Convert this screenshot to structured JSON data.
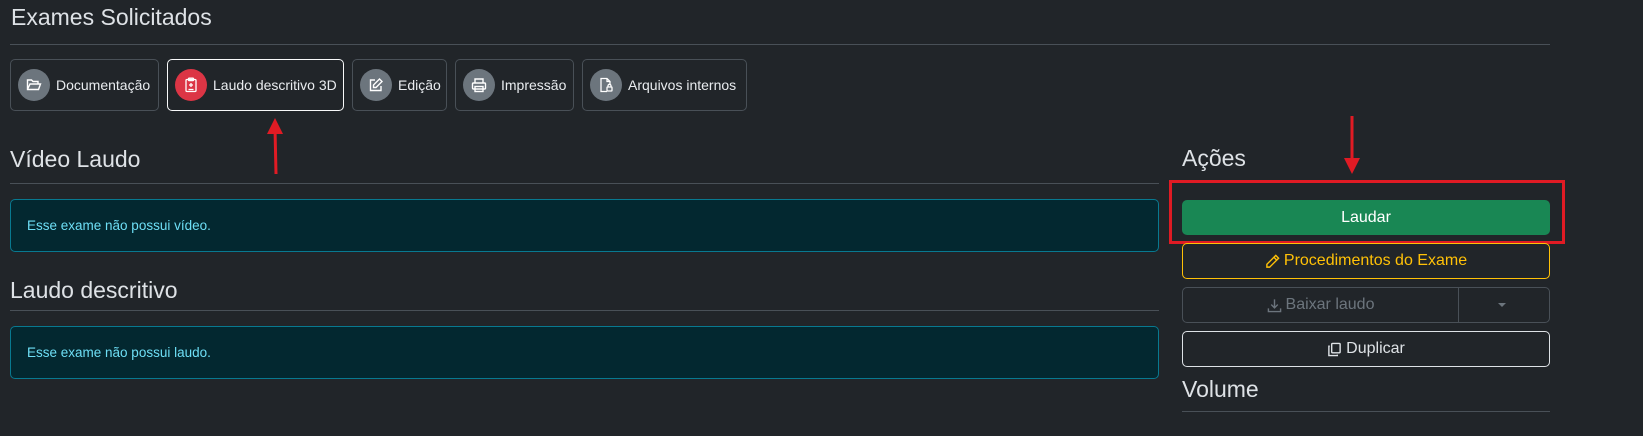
{
  "header": {
    "title": "Exames Solicitados"
  },
  "tabs": [
    {
      "label": "Documentação",
      "icon": "folder-open-icon",
      "active": false
    },
    {
      "label": "Laudo descritivo 3D",
      "icon": "clipboard-medical-icon",
      "active": true
    },
    {
      "label": "Edição",
      "icon": "edit-icon",
      "active": false
    },
    {
      "label": "Impressão",
      "icon": "printer-icon",
      "active": false
    },
    {
      "label": "Arquivos internos",
      "icon": "file-lock-icon",
      "active": false
    }
  ],
  "video_section": {
    "title": "Vídeo Laudo",
    "alert": "Esse exame não possui vídeo."
  },
  "laudo_section": {
    "title": "Laudo descritivo",
    "alert": "Esse exame não possui laudo."
  },
  "actions": {
    "title": "Ações",
    "laudar_label": "Laudar",
    "procedimentos_label": "Procedimentos do Exame",
    "baixar_label": "Baixar laudo",
    "duplicar_label": "Duplicar"
  },
  "volume_section": {
    "title": "Volume"
  },
  "colors": {
    "background": "#212529",
    "success": "#198754",
    "warning": "#ffc107",
    "danger": "#dc3545",
    "annotation": "#e01b24",
    "info_text": "#6edff6"
  }
}
